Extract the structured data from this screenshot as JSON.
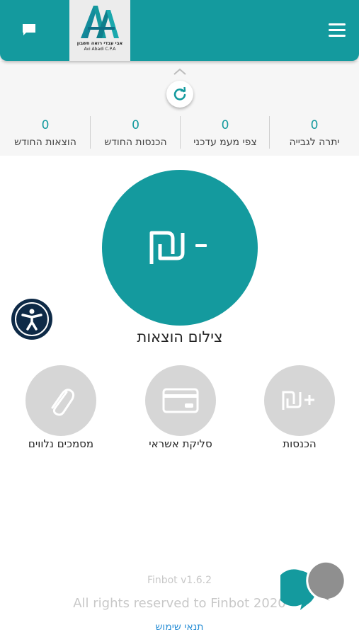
{
  "header": {
    "logo": {
      "line1": "אבי עבדי רואה חשבון",
      "line2": "Avi Abadi C.P.A"
    },
    "colors": {
      "brand": "#149a9e",
      "header_bg": "#149a9e"
    }
  },
  "stats": [
    {
      "value": "0",
      "label": "יתרה לגבייה"
    },
    {
      "value": "0",
      "label": "צפי מעמ עדכני"
    },
    {
      "value": "0",
      "label": "הכנסות החודש"
    },
    {
      "value": "0",
      "label": "הוצאות החודש"
    }
  ],
  "main_action": {
    "symbol": "₪",
    "label": "צילום הוצאות"
  },
  "actions": [
    {
      "icon": "plus-shekel-icon",
      "label": "הכנסות"
    },
    {
      "icon": "credit-card-icon",
      "label": "סליקת אשראי"
    },
    {
      "icon": "paperclip-icon",
      "label": "מסמכים נלווים"
    }
  ],
  "footer": {
    "version": "Finbot v1.6.2",
    "rights": "All rights reserved to Finbot 2020",
    "terms": "תנאי שימוש"
  }
}
